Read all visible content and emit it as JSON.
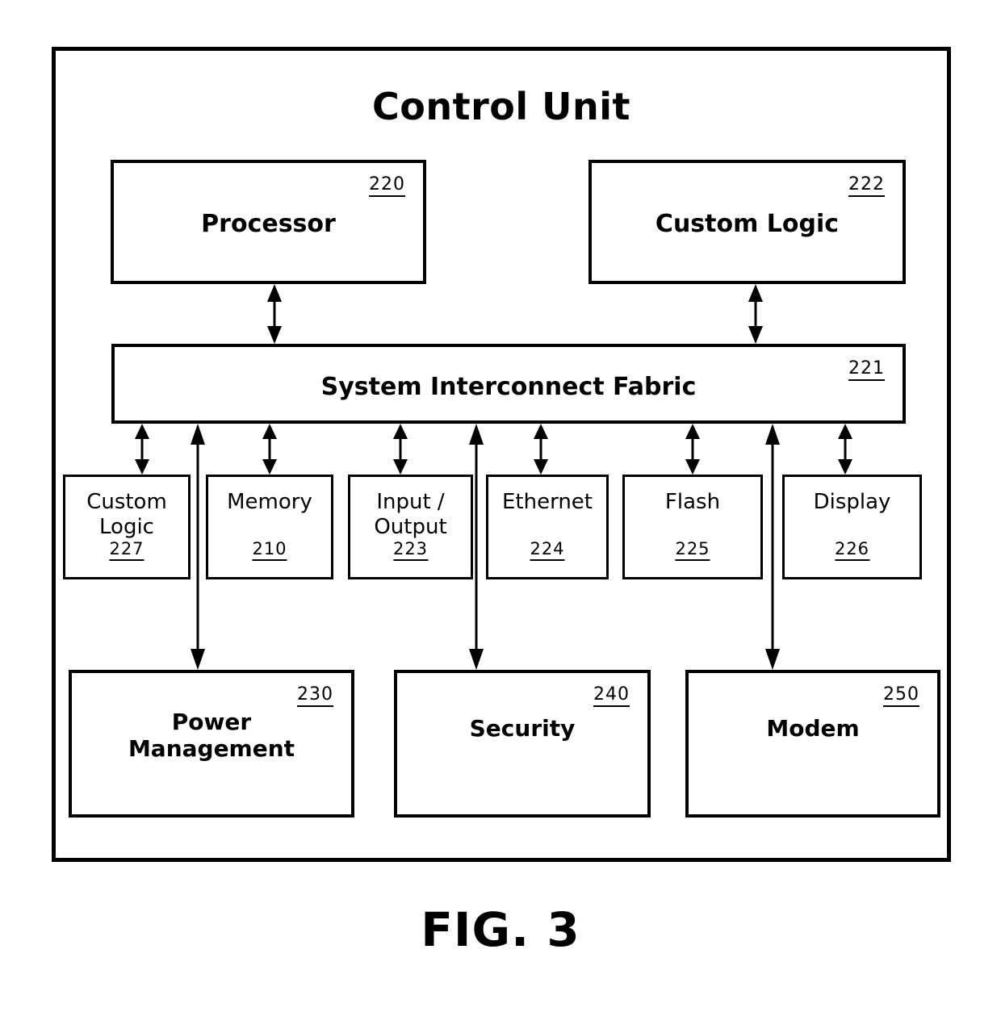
{
  "figure": {
    "caption": "FIG. 3",
    "title": "Control Unit"
  },
  "blocks": {
    "processor": {
      "label": "Processor",
      "ref": "220"
    },
    "custom_logic_top": {
      "label": "Custom Logic",
      "ref": "222"
    },
    "fabric": {
      "label": "System Interconnect Fabric",
      "ref": "221"
    },
    "custom_logic_periph": {
      "label_line1": "Custom",
      "label_line2": "Logic",
      "ref": "227"
    },
    "memory": {
      "label": "Memory",
      "ref": "210"
    },
    "input_output": {
      "label_line1": "Input /",
      "label_line2": "Output",
      "ref": "223"
    },
    "ethernet": {
      "label": "Ethernet",
      "ref": "224"
    },
    "flash": {
      "label": "Flash",
      "ref": "225"
    },
    "display": {
      "label": "Display",
      "ref": "226"
    },
    "power_management": {
      "label_line1": "Power",
      "label_line2": "Management",
      "ref": "230"
    },
    "security": {
      "label": "Security",
      "ref": "240"
    },
    "modem": {
      "label": "Modem",
      "ref": "250"
    }
  },
  "colors": {
    "line": "#000000",
    "background": "#ffffff"
  },
  "connections": [
    {
      "from": "processor",
      "to": "fabric",
      "style": "double-arrow"
    },
    {
      "from": "custom_logic_top",
      "to": "fabric",
      "style": "double-arrow"
    },
    {
      "from": "fabric",
      "to": "custom_logic_periph",
      "style": "double-arrow"
    },
    {
      "from": "fabric",
      "to": "memory",
      "style": "double-arrow"
    },
    {
      "from": "fabric",
      "to": "input_output",
      "style": "double-arrow"
    },
    {
      "from": "fabric",
      "to": "ethernet",
      "style": "double-arrow"
    },
    {
      "from": "fabric",
      "to": "flash",
      "style": "double-arrow"
    },
    {
      "from": "fabric",
      "to": "display",
      "style": "double-arrow"
    },
    {
      "from": "fabric",
      "to": "power_management",
      "style": "double-arrow"
    },
    {
      "from": "fabric",
      "to": "security",
      "style": "double-arrow"
    },
    {
      "from": "fabric",
      "to": "modem",
      "style": "double-arrow"
    }
  ]
}
